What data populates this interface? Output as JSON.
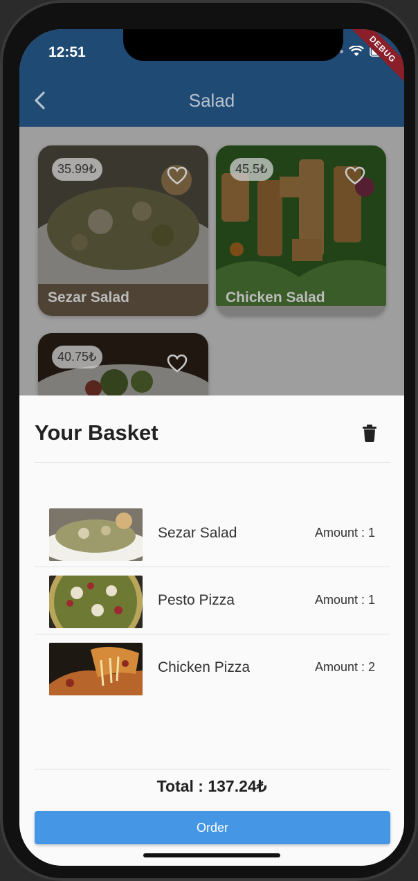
{
  "status_bar": {
    "time": "12:51",
    "debug_label": "DEBUG"
  },
  "appbar": {
    "title": "Salad"
  },
  "products": [
    {
      "price": "35.99₺",
      "name": "Sezar Salad"
    },
    {
      "price": "45.5₺",
      "name": "Chicken Salad"
    },
    {
      "price": "40.75₺",
      "name": ""
    }
  ],
  "basket": {
    "title": "Your Basket",
    "items": [
      {
        "name": "Sezar Salad",
        "amount": "Amount : 1"
      },
      {
        "name": "Pesto Pizza",
        "amount": "Amount : 1"
      },
      {
        "name": "Chicken Pizza",
        "amount": "Amount : 2"
      }
    ],
    "total": "Total : 137.24₺",
    "order_label": "Order"
  },
  "colors": {
    "appbar": "#1f4a73",
    "order_button": "#4597e6",
    "debug_banner": "#8a1f2a"
  }
}
